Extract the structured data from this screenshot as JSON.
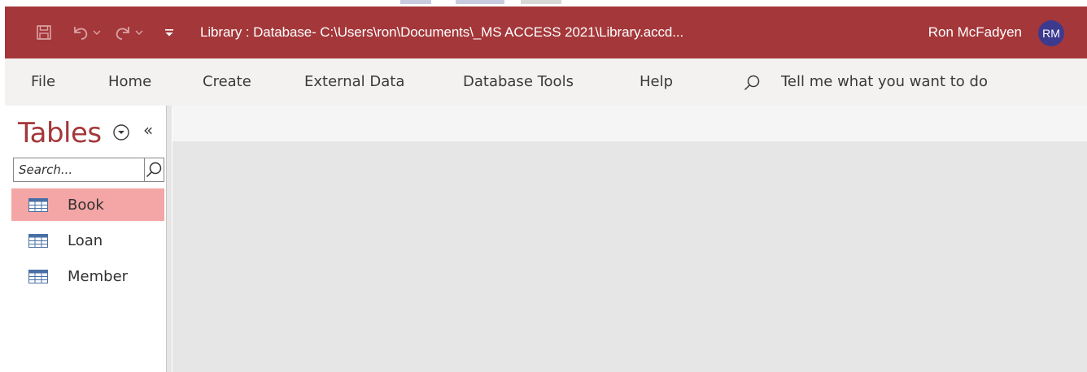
{
  "window": {
    "title": "Library : Database- C:\\Users\\ron\\Documents\\_MS ACCESS 2021\\Library.accd...",
    "user_name": "Ron McFadyen",
    "user_initials": "RM",
    "colors": {
      "title_bar": "#a4373a",
      "avatar": "#3c3a8e",
      "selected_item": "#f4a6a6",
      "workspace": "#e6e6e6"
    }
  },
  "quick_access": {
    "icons": [
      "save-icon",
      "undo-icon",
      "redo-icon",
      "customize-quick-access-icon"
    ]
  },
  "ribbon": {
    "tabs": [
      {
        "label": "File"
      },
      {
        "label": "Home"
      },
      {
        "label": "Create"
      },
      {
        "label": "External Data"
      },
      {
        "label": "Database Tools"
      },
      {
        "label": "Help"
      }
    ],
    "tell_me": "Tell me what you want to do"
  },
  "nav_pane": {
    "title": "Tables",
    "collapse_glyph": "«",
    "search_placeholder": "Search...",
    "items": [
      {
        "label": "Book",
        "selected": true
      },
      {
        "label": "Loan",
        "selected": false
      },
      {
        "label": "Member",
        "selected": false
      }
    ]
  }
}
